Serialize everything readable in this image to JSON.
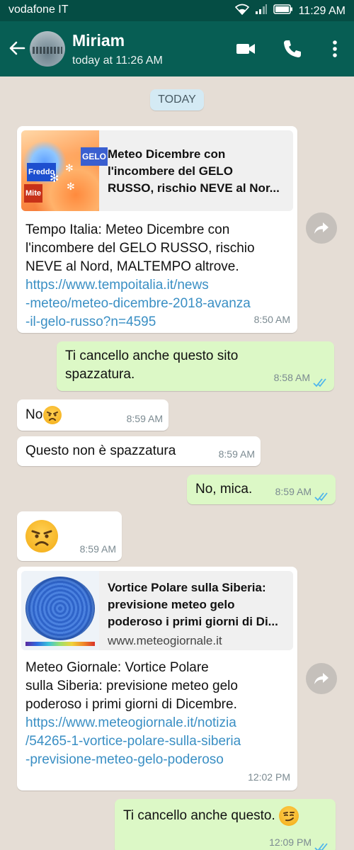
{
  "status_bar": {
    "carrier": "vodafone IT",
    "time": "11:29 AM",
    "icons": [
      "wifi-icon",
      "signal-icon",
      "battery-icon"
    ]
  },
  "header": {
    "contact_name": "Miriam",
    "last_seen": "today at 11:26 AM",
    "actions": [
      "video-call-icon",
      "phone-icon",
      "more-vert-icon"
    ]
  },
  "chat": {
    "day_chip": "TODAY",
    "messages": [
      {
        "direction": "incoming",
        "preview_title": "Meteo Dicembre con l'incombere del GELO RUSSO, rischio NEVE al Nor...",
        "preview_title_lines": [
          "Meteo Dicembre con",
          "l'incombere del GELO",
          "RUSSO, rischio NEVE al Nor..."
        ],
        "thumb_labels": [
          "GELO",
          "Freddo",
          "Mite"
        ],
        "text_lines": [
          "Tempo Italia: Meteo Dicembre con",
          "l'incombere del GELO RUSSO, rischio",
          "NEVE al Nord, MALTEMPO altrove."
        ],
        "link_lines": [
          "https://www.tempoitalia.it/news",
          "-meteo/meteo-dicembre-2018-avanza",
          "-il-gelo-russo?n=4595"
        ],
        "time": "8:50 AM"
      },
      {
        "direction": "outgoing",
        "text_lines": [
          "Ti cancello anche questo sito",
          "spazzatura."
        ],
        "time": "8:58 AM",
        "status": "read"
      },
      {
        "direction": "incoming",
        "text": "No",
        "emoji": "angry-face",
        "time": "8:59 AM"
      },
      {
        "direction": "incoming",
        "text": "Questo non è spazzatura",
        "time": "8:59 AM"
      },
      {
        "direction": "outgoing",
        "text": "No, mica.",
        "time": "8:59 AM",
        "status": "read"
      },
      {
        "direction": "incoming",
        "emoji": "angry-face",
        "time": "8:59 AM"
      },
      {
        "direction": "incoming",
        "preview_title_lines": [
          "Vortice Polare sulla Siberia:",
          "previsione meteo gelo",
          "poderoso i primi giorni di Di..."
        ],
        "preview_domain": "www.meteogiornale.it",
        "text_lines": [
          "Meteo Giornale: Vortice Polare",
          "sulla Siberia: previsione meteo gelo",
          "poderoso i primi giorni di Dicembre."
        ],
        "link_lines": [
          "https://www.meteogiornale.it/notizia",
          "/54265-1-vortice-polare-sulla-siberia",
          "-previsione-meteo-gelo-poderoso"
        ],
        "time": "12:02 PM"
      },
      {
        "direction": "outgoing",
        "text": "Ti cancello anche questo.",
        "emoji": "smirking-face",
        "time": "12:09 PM",
        "status": "read"
      }
    ]
  },
  "colors": {
    "header": "#075e54",
    "status_bar": "#054d44",
    "chat_background": "#e5ddd5",
    "outgoing_bubble": "#dcf8c6",
    "incoming_bubble": "#ffffff",
    "link": "#3a8fc4",
    "read_ticks": "#4fb6ec"
  }
}
